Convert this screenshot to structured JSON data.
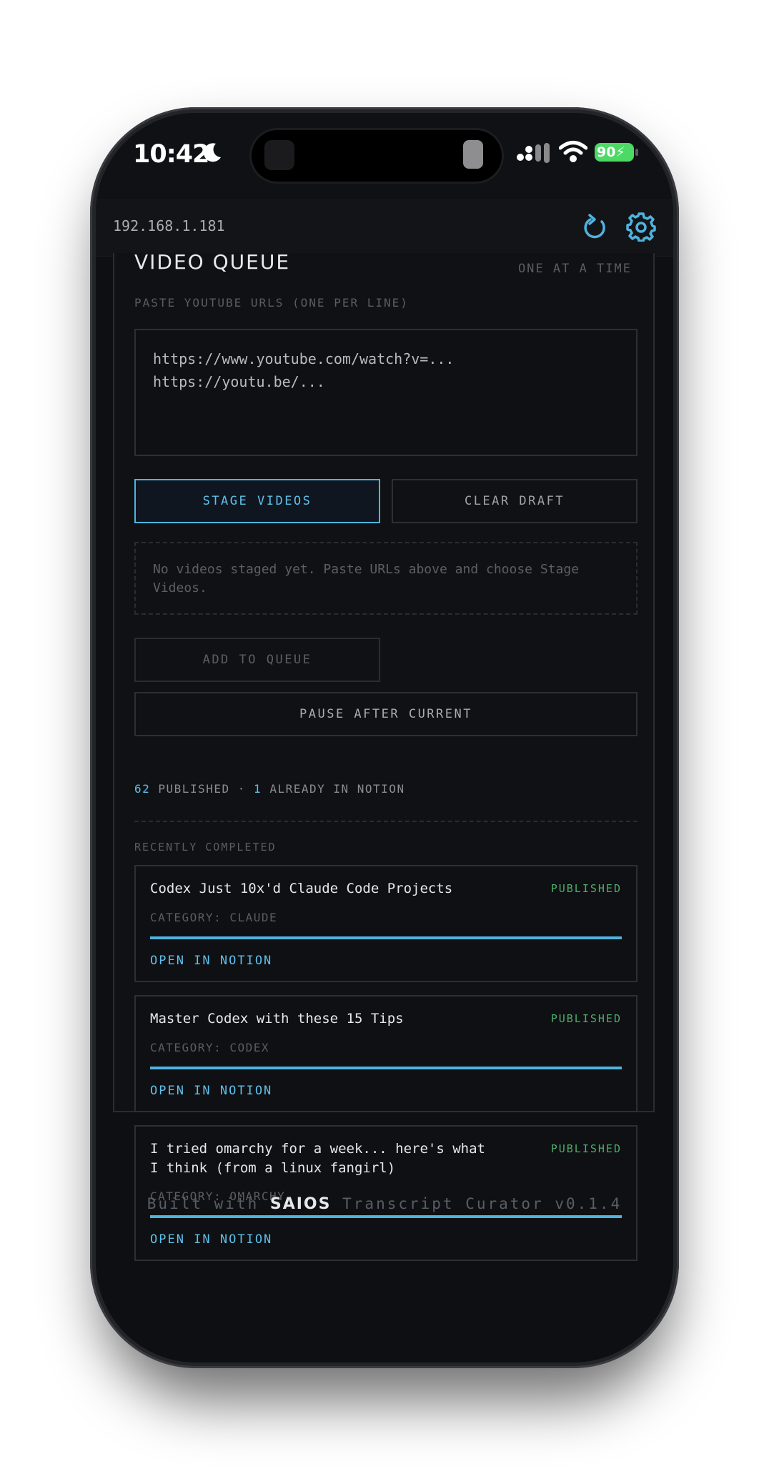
{
  "status_bar": {
    "time": "10:42",
    "battery": "90"
  },
  "browser": {
    "url": "192.168.1.181"
  },
  "queue": {
    "title": "VIDEO QUEUE",
    "subtitle": "ONE AT A TIME",
    "paste_label": "PASTE YOUTUBE URLS (ONE PER LINE)",
    "textarea_placeholder": "https://www.youtube.com/watch?v=...\nhttps://youtu.be/...",
    "stage_button": "STAGE VIDEOS",
    "clear_button": "CLEAR DRAFT",
    "empty_note": "No videos staged yet. Paste URLs above and choose Stage Videos.",
    "add_button": "ADD TO QUEUE",
    "pause_button": "PAUSE AFTER CURRENT"
  },
  "stats": {
    "published_count": "62",
    "published_label": "PUBLISHED",
    "separator": "·",
    "notion_count": "1",
    "notion_label": "ALREADY IN NOTION"
  },
  "recent": {
    "label": "RECENTLY COMPLETED",
    "items": [
      {
        "title": "Codex Just 10x'd Claude Code Projects",
        "status": "PUBLISHED",
        "category": "CATEGORY: CLAUDE",
        "progress": 1.0,
        "link": "OPEN IN NOTION"
      },
      {
        "title": "Master Codex with these 15 Tips",
        "status": "PUBLISHED",
        "category": "CATEGORY: CODEX",
        "progress": 1.0,
        "link": "OPEN IN NOTION"
      },
      {
        "title": "I tried omarchy for a week... here's what I think (from a linux fangirl)",
        "status": "PUBLISHED",
        "category": "CATEGORY: OMARCHY",
        "progress": 1.0,
        "link": "OPEN IN NOTION"
      }
    ]
  },
  "footer": {
    "prefix": "Built with",
    "brand": "SAIOS",
    "suffix": "Transcript Curator v0.1.4"
  },
  "colors": {
    "accent": "#4fb3e0",
    "published": "#4caf6a",
    "background": "#0e0f12"
  },
  "icons": {
    "refresh": "refresh-icon",
    "settings": "gear-icon",
    "moon": "moon-icon",
    "wifi": "wifi-icon",
    "signal": "signal-icon"
  }
}
